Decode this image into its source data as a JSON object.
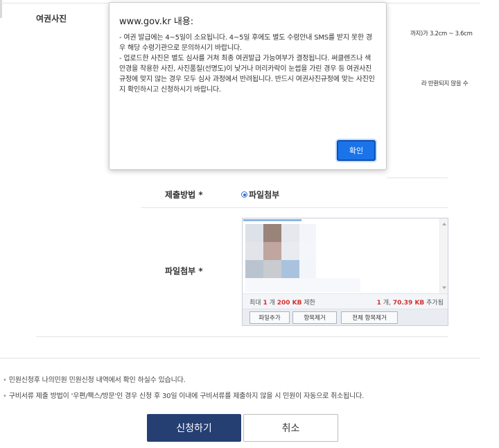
{
  "form": {
    "photo_label": "여권사진",
    "side_text_1": "까지)가 3.2cm ~ 3.6cm",
    "side_text_2": "라 반환되지 않을 수",
    "submit_method_label": "제출방법 *",
    "submit_method_value": "파일첨부",
    "attachment_label": "파일첨부 *"
  },
  "file_upload": {
    "max_prefix": "최대",
    "max_count": "1",
    "max_count_unit": "개",
    "max_size": "200 KB",
    "max_suffix": "제한",
    "added_count": "1",
    "added_count_unit": "개,",
    "added_size": "70.39 KB",
    "added_suffix": "추가됨",
    "add_button": "파일추가",
    "remove_button": "항목제거",
    "remove_all_button": "전체 항목제거"
  },
  "notices": [
    "민원신청후 나의민원 민원신청 내역에서 확인 하실수 있습니다.",
    "구비서류 제출 방법이 '우편/팩스/방문'인 경우 신청 후 30일 이내에 구비서류를 제출하지 않을 시 민원이 자동으로 취소됩니다."
  ],
  "buttons": {
    "submit": "신청하기",
    "cancel": "취소"
  },
  "dialog": {
    "title": "www.gov.kr 내용:",
    "line_1": "- 여권 발급에는 4~5일이 소요됩니다. 4~5일 후에도 별도 수령안내 SMS를 받지 못한 경우 해당 수령기관으로 문의하시기 바랍니다.",
    "line_2": "- 업로드한 사진은 별도 심사를 거쳐 최종 여권발급 가능여부가 결정됩니다. 써클렌즈나 색안경을 착용한 사진, 사진품질(선명도)이 낮거나 머리카락이 눈썹을 가린 경우 등 여권사진규정에 맞지 않는 경우 모두 심사 과정에서 반려됩니다. 반드시 여권사진규정에 맞는 사진인지 확인하시고 신청하시기 바랍니다.",
    "ok_button": "확인"
  },
  "colors": {
    "primary_button": "#253f73",
    "dialog_ok": "#1a73e8",
    "highlight_red": "#d43030",
    "radio": "#2f6fd6"
  }
}
